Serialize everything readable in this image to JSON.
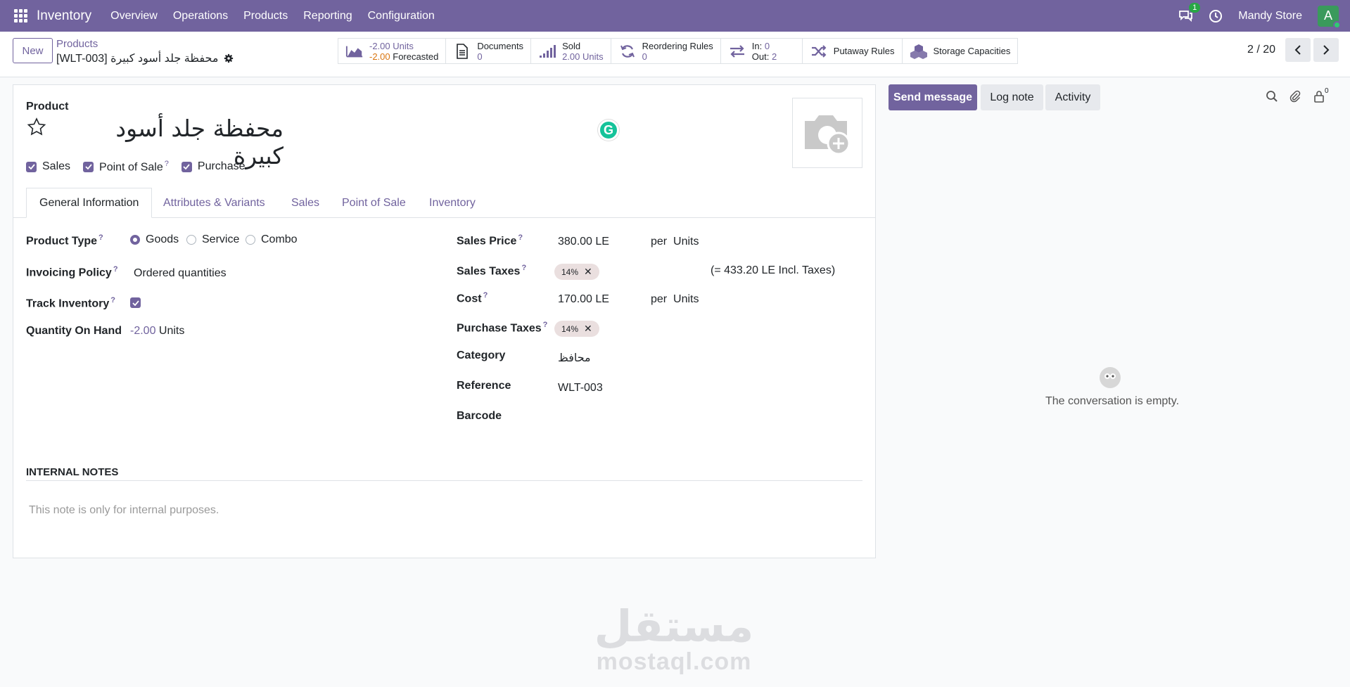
{
  "navbar": {
    "app_name": "Inventory",
    "menu": [
      "Overview",
      "Operations",
      "Products",
      "Reporting",
      "Configuration"
    ],
    "chat_count": "1",
    "company": "Mandy Store",
    "avatar_letter": "A"
  },
  "control": {
    "new_label": "New",
    "breadcrumb_parent": "Products",
    "breadcrumb_current": "[WLT-003] محفظة جلد أسود كبيرة",
    "pager": "2 / 20"
  },
  "smart_buttons": {
    "onhand_value": "-2.00 Units",
    "forecast_value": "-2.00",
    "forecast_label": "Forecasted",
    "documents_label": "Documents",
    "documents_value": "0",
    "sold_label": "Sold",
    "sold_value": "2.00 Units",
    "reorder_label": "Reordering Rules",
    "reorder_value": "0",
    "in_label": "In:",
    "in_value": "0",
    "out_label": "Out:",
    "out_value": "2",
    "putaway_label": "Putaway Rules",
    "storage_label": "Storage Capacities"
  },
  "form": {
    "product_label": "Product",
    "product_name": "محفظة جلد أسود كبيرة",
    "checks": {
      "sales": "Sales",
      "pos": "Point of Sale",
      "purchase": "Purchase"
    },
    "tabs": [
      "General Information",
      "Attributes & Variants",
      "Sales",
      "Point of Sale",
      "Inventory"
    ],
    "product_type_label": "Product Type",
    "product_type_options": [
      "Goods",
      "Service",
      "Combo"
    ],
    "invoicing_label": "Invoicing Policy",
    "invoicing_value": "Ordered quantities",
    "track_label": "Track Inventory",
    "qty_label": "Quantity On Hand",
    "qty_value": "-2.00",
    "qty_unit": "Units",
    "sales_price_label": "Sales Price",
    "sales_price_value": "380.00 LE",
    "per": "per",
    "units": "Units",
    "sales_taxes_label": "Sales Taxes",
    "tax_tag": "14%",
    "incl_taxes": "(= 433.20 LE Incl. Taxes)",
    "cost_label": "Cost",
    "cost_value": "170.00 LE",
    "purchase_taxes_label": "Purchase Taxes",
    "category_label": "Category",
    "category_value": "محافظ",
    "reference_label": "Reference",
    "reference_value": "WLT-003",
    "barcode_label": "Barcode",
    "notes_title": "INTERNAL NOTES",
    "notes_placeholder": "This note is only for internal purposes."
  },
  "chatter": {
    "send_message": "Send message",
    "log_note": "Log note",
    "activity": "Activity",
    "follower_count": "0",
    "empty_text": "The conversation is empty."
  },
  "watermark": {
    "arabic": "مستقل",
    "latin": "mostaql.com"
  },
  "colors": {
    "brand": "#71639e",
    "forecast": "#d9750f",
    "tag_bg": "#eadfdf"
  }
}
